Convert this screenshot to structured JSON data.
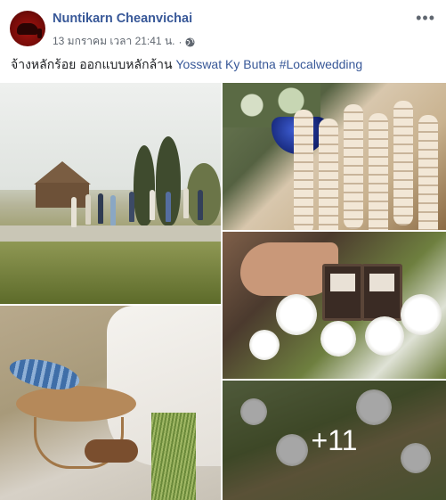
{
  "post": {
    "author": "Nuntikarn Cheanvichai",
    "timestamp": "13 มกราคม เวลา 21:41 น.",
    "separator": "·",
    "audience_icon": "globe-icon",
    "options_icon": "more-options-icon",
    "options_label": "•••",
    "text": "จ้างหลักร้อย ออกแบบหลักล้าน",
    "tags": "Yosswat Ky Butna #Localwedding"
  },
  "photos": {
    "more_count": "+11"
  },
  "colors": {
    "link": "#385898",
    "text": "#1c1e21",
    "meta": "#606770"
  }
}
